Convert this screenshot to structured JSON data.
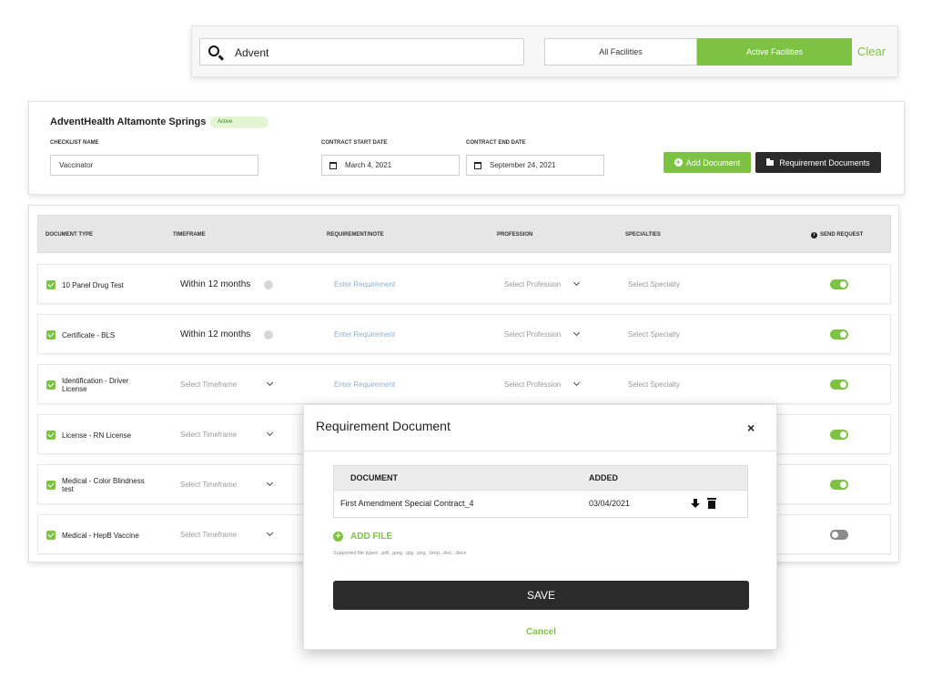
{
  "search": {
    "value": "Advent",
    "filter_all": "All Facilities",
    "filter_active": "Active Facilities",
    "clear": "Clear"
  },
  "facility": {
    "name": "AdventHealth Altamonte Springs",
    "status": "Active",
    "checklist_label": "CHECKLIST NAME",
    "checklist_value": "Vaccinator",
    "start_label": "CONTRACT START DATE",
    "start_value": "March 4, 2021",
    "end_label": "CONTRACT END DATE",
    "end_value": "September 24, 2021",
    "add_document": "Add Document",
    "requirement_documents": "Requirement Documents"
  },
  "table": {
    "headers": {
      "document_type": "DOCUMENT TYPE",
      "timeframe": "TIMEFRAME",
      "requirement": "REQUIREMENT/NOTE",
      "profession": "PROFESSION",
      "specialties": "SPECIALTIES",
      "send_request": "SEND REQUEST"
    },
    "placeholders": {
      "timeframe": "Select Timeframe",
      "requirement": "Enter Requirement",
      "profession": "Select Profession",
      "specialty": "Select Specialty"
    },
    "rows": [
      {
        "document": "10 Panel Drug Test",
        "timeframe": "Within 12 months",
        "send_request": true
      },
      {
        "document": "Certificate - BLS",
        "timeframe": "Within 12 months",
        "send_request": true
      },
      {
        "document": "Identification - Driver License",
        "timeframe": "",
        "send_request": true
      },
      {
        "document": "License - RN License",
        "timeframe": "",
        "send_request": true
      },
      {
        "document": "Medical - Color Blindness test",
        "timeframe": "",
        "send_request": true
      },
      {
        "document": "Medical - HepB Vaccine",
        "timeframe": "",
        "send_request": false
      }
    ]
  },
  "modal": {
    "title": "Requirement Document",
    "close": "×",
    "col_document": "DOCUMENT",
    "col_added": "ADDED",
    "file_name": "First Amendment Special Contract_4",
    "file_added": "03/04/2021",
    "add_file": "ADD FILE",
    "hint": "Supported file types: .pdf, .jpeg, .jpg, .png, .bmp, .doc, .docx",
    "save": "SAVE",
    "cancel": "Cancel"
  },
  "colors": {
    "accent": "#7dc243",
    "dark": "#2b2b2b"
  }
}
